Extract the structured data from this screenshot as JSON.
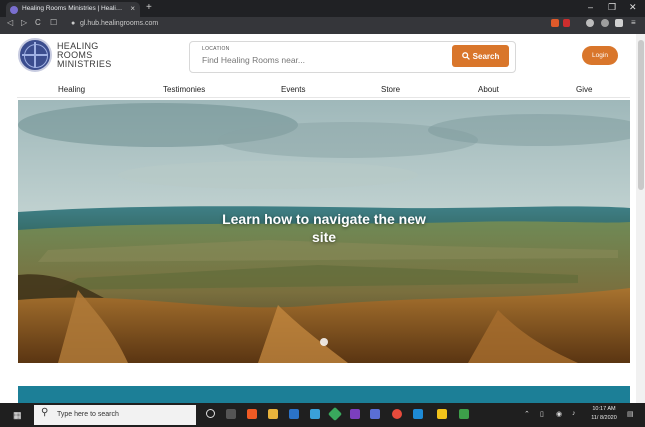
{
  "browser": {
    "tab_title": "Healing Rooms Ministries | Heali…",
    "tab_close": "×",
    "new_tab": "+",
    "url": "gl.hub.healingrooms.com",
    "controls": {
      "minimize": "–",
      "maximize": "❐",
      "close": "✕"
    },
    "nav": {
      "back": "◁",
      "forward": "▷",
      "reload": "C",
      "bookmark": "☐",
      "lock": "🔒"
    }
  },
  "site": {
    "brand_lines": [
      "HEALING",
      "ROOMS",
      "MINISTRIES"
    ],
    "search": {
      "label": "LOCATION",
      "placeholder": "Find Healing Rooms near...",
      "button": "Search"
    },
    "login": "Login",
    "nav": [
      "Healing",
      "Testimonies",
      "Events",
      "Store",
      "About",
      "Give"
    ],
    "hero_heading": "Learn how to navigate the new site",
    "accent": "#d9762b",
    "band_color": "#1c7f97"
  },
  "taskbar": {
    "search_placeholder": "Type here to search",
    "time": "10:17 AM",
    "date": "11/ 8/2020"
  }
}
